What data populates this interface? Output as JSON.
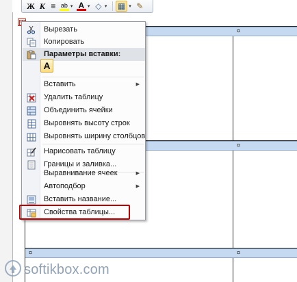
{
  "toolbar": {
    "bold": "Ж",
    "italic": "К",
    "align_icon": "≡",
    "highlight_icon": "ab",
    "font_color_icon": "A",
    "shading_icon": "◇",
    "borders_icon": "▦",
    "format_painter_icon": "✎",
    "arrow": "▾"
  },
  "table": {
    "cell_mark": "¤"
  },
  "menu": {
    "items": [
      {
        "label": "Вырезать",
        "icon": "scissors-icon"
      },
      {
        "label": "Копировать",
        "icon": "copy-icon"
      },
      {
        "label": "Параметры вставки:",
        "icon": "paste-icon"
      },
      {
        "label": "Вставить",
        "icon": "",
        "submenu": "▶"
      },
      {
        "label": "Удалить таблицу",
        "icon": "delete-table-icon"
      },
      {
        "label": "Объединить ячейки",
        "icon": "merge-cells-icon"
      },
      {
        "label": "Выровнять высоту строк",
        "icon": "distribute-rows-icon"
      },
      {
        "label": "Выровнять ширину столбцов",
        "icon": "distribute-columns-icon"
      },
      {
        "label": "Нарисовать таблицу",
        "icon": "draw-table-icon"
      },
      {
        "label": "Границы и заливка...",
        "icon": "borders-shading-icon"
      },
      {
        "label": "Выравнивание ячеек",
        "icon": "",
        "submenu": "▶"
      },
      {
        "label": "Автоподбор",
        "icon": "",
        "submenu": "▶"
      },
      {
        "label": "Вставить название...",
        "icon": "insert-caption-icon"
      },
      {
        "label": "Свойства таблицы...",
        "icon": "table-properties-icon"
      }
    ],
    "paste_option": "A"
  },
  "watermark": {
    "text": "softikbox.com"
  },
  "colors": {
    "header_row": "#c5d9f1",
    "highlight": "#c00000",
    "menu_bg": "#fcfcfd"
  }
}
